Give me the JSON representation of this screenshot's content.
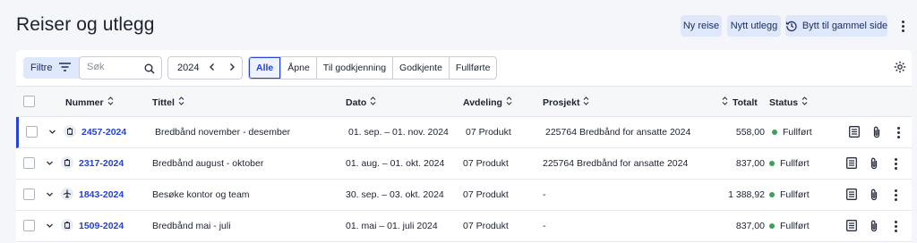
{
  "page": {
    "title": "Reiser og utlegg",
    "actions": {
      "new_trip": "Ny reise",
      "new_expense": "Nytt utlegg",
      "switch_old": "Bytt til gammel side"
    }
  },
  "toolbar": {
    "filter_label": "Filtre",
    "search_placeholder": "Søk",
    "year": "2024",
    "segments": [
      "Alle",
      "Åpne",
      "Til godkjenning",
      "Godkjente",
      "Fullførte"
    ],
    "active_segment": "Alle"
  },
  "table": {
    "columns": {
      "number": "Nummer",
      "title": "Tittel",
      "date": "Dato",
      "department": "Avdeling",
      "project": "Prosjekt",
      "total": "Totalt",
      "status": "Status"
    },
    "rows": [
      {
        "type_icon": "receipt-icon",
        "number": "2457-2024",
        "title": "Bredbånd november - desember",
        "date": "01. sep. – 01. nov. 2024",
        "department": "07 Produkt",
        "project": "225764 Bredbånd for ansatte 2024",
        "total": "558,00",
        "status": "Fullført"
      },
      {
        "type_icon": "receipt-icon",
        "number": "2317-2024",
        "title": "Bredbånd august - oktober",
        "date": "01. aug. – 01. okt. 2024",
        "department": "07 Produkt",
        "project": "225764 Bredbånd for ansatte 2024",
        "total": "837,00",
        "status": "Fullført"
      },
      {
        "type_icon": "plane-icon",
        "number": "1843-2024",
        "title": "Besøke kontor og team",
        "date": "30. sep. – 03. okt. 2024",
        "department": "07 Produkt",
        "project": "-",
        "total": "1 388,92",
        "status": "Fullført"
      },
      {
        "type_icon": "receipt-icon",
        "number": "1509-2024",
        "title": "Bredbånd mai - juli",
        "date": "01. mai – 01. juli 2024",
        "department": "07 Produkt",
        "project": "-",
        "total": "837,00",
        "status": "Fullført"
      }
    ]
  },
  "colors": {
    "accent": "#2441d8",
    "status_done": "#3aa35a",
    "soft_button": "#dfe7fb"
  }
}
